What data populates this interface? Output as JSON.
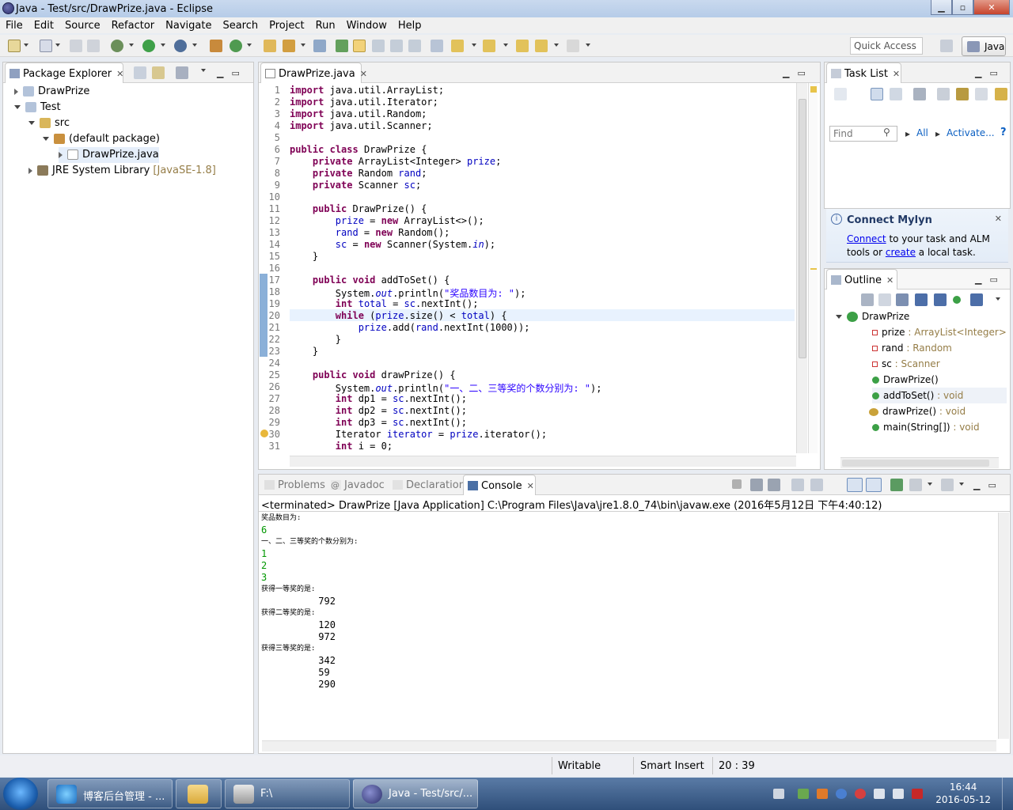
{
  "window": {
    "title": "Java - Test/src/DrawPrize.java - Eclipse",
    "min_icon": "minimize-icon",
    "max_icon": "maximize-icon",
    "close_icon": "close-icon"
  },
  "menu": [
    "File",
    "Edit",
    "Source",
    "Refactor",
    "Navigate",
    "Search",
    "Project",
    "Run",
    "Window",
    "Help"
  ],
  "toolbar": {
    "quick_access": "Quick Access",
    "perspective": "Java"
  },
  "package_explorer": {
    "tab": "Package Explorer",
    "items": [
      {
        "label": "DrawPrize"
      },
      {
        "label": "Test"
      },
      {
        "label": "src"
      },
      {
        "label": "(default package)"
      },
      {
        "label": "DrawPrize.java"
      },
      {
        "label": "JRE System Library",
        "suffix": "[JavaSE-1.8]"
      }
    ]
  },
  "editor": {
    "tab": "DrawPrize.java",
    "lines": [
      "import java.util.ArrayList;",
      "import java.util.Iterator;",
      "import java.util.Random;",
      "import java.util.Scanner;",
      "",
      "public class DrawPrize {",
      "    private ArrayList<Integer> prize;",
      "    private Random rand;",
      "    private Scanner sc;",
      "",
      "    public DrawPrize() {",
      "        prize = new ArrayList<>();",
      "        rand = new Random();",
      "        sc = new Scanner(System.in);",
      "    }",
      "",
      "    public void addToSet() {",
      "        System.out.println(\"奖品数目为: \");",
      "        int total = sc.nextInt();",
      "        while (prize.size() < total) {",
      "            prize.add(rand.nextInt(1000));",
      "        }",
      "    }",
      "",
      "    public void drawPrize() {",
      "        System.out.println(\"一、二、三等奖的个数分别为: \");",
      "        int dp1 = sc.nextInt();",
      "        int dp2 = sc.nextInt();",
      "        int dp3 = sc.nextInt();",
      "        Iterator iterator = prize.iterator();",
      "        int i = 0;"
    ]
  },
  "task_list": {
    "tab": "Task List",
    "find_placeholder": "Find",
    "all": "All",
    "activate": "Activate..."
  },
  "mylyn": {
    "title": "Connect Mylyn",
    "connect": "Connect",
    "text1": " to your task and ALM",
    "text2": "tools or ",
    "create": "create",
    "text3": " a local task."
  },
  "outline": {
    "tab": "Outline",
    "root": "DrawPrize",
    "items": [
      {
        "name": "prize",
        "type": " : ArrayList<Integer>"
      },
      {
        "name": "rand",
        "type": " : Random"
      },
      {
        "name": "sc",
        "type": " : Scanner"
      },
      {
        "name": "DrawPrize()",
        "type": ""
      },
      {
        "name": "addToSet()",
        "type": " : void"
      },
      {
        "name": "drawPrize()",
        "type": " : void"
      },
      {
        "name": "main(String[])",
        "type": " : void"
      }
    ]
  },
  "bottom_tabs": {
    "problems": "Problems",
    "javadoc": "Javadoc",
    "declaration": "Declaration",
    "console": "Console"
  },
  "console": {
    "header": "<terminated> DrawPrize [Java Application] C:\\Program Files\\Java\\jre1.8.0_74\\bin\\javaw.exe (2016年5月12日 下午4:40:12)",
    "lines": [
      {
        "t": "奖品数目为:",
        "k": "small"
      },
      {
        "t": "6",
        "k": "in"
      },
      {
        "t": "一、二、三等奖的个数分别为:",
        "k": "small"
      },
      {
        "t": "1",
        "k": "in"
      },
      {
        "t": "2",
        "k": "in"
      },
      {
        "t": "3",
        "k": "in"
      },
      {
        "t": "获得一等奖的是:",
        "k": "small"
      },
      {
        "t": "          792",
        "k": "out"
      },
      {
        "t": "获得二等奖的是:",
        "k": "small"
      },
      {
        "t": "          120",
        "k": "out"
      },
      {
        "t": "          972",
        "k": "out"
      },
      {
        "t": "获得三等奖的是:",
        "k": "small"
      },
      {
        "t": "          342",
        "k": "out"
      },
      {
        "t": "          59",
        "k": "out"
      },
      {
        "t": "          290",
        "k": "out"
      }
    ]
  },
  "status": {
    "writable": "Writable",
    "insert": "Smart Insert",
    "position": "20 : 39"
  },
  "taskbar": {
    "items": [
      "博客后台管理 - ...",
      "",
      "F:\\",
      "Java - Test/src/..."
    ],
    "time": "16:44",
    "date": "2016-05-12"
  }
}
